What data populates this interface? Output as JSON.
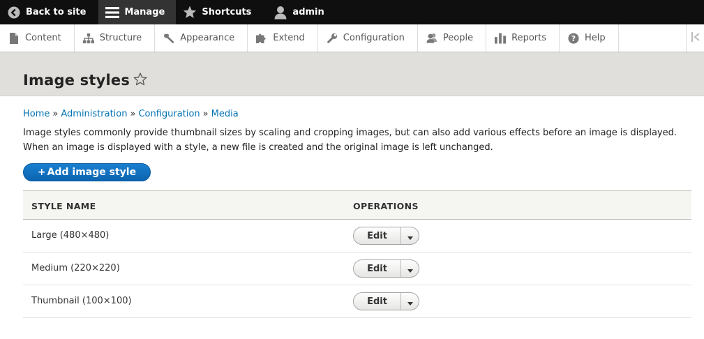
{
  "toolbar": {
    "back_label": "Back to site",
    "manage_label": "Manage",
    "shortcuts_label": "Shortcuts",
    "user_label": "admin"
  },
  "tray": {
    "items": [
      {
        "label": "Content",
        "icon": "document-icon"
      },
      {
        "label": "Structure",
        "icon": "structure-icon"
      },
      {
        "label": "Appearance",
        "icon": "paintbrush-icon"
      },
      {
        "label": "Extend",
        "icon": "puzzle-icon"
      },
      {
        "label": "Configuration",
        "icon": "wrench-icon"
      },
      {
        "label": "People",
        "icon": "people-icon"
      },
      {
        "label": "Reports",
        "icon": "bar-chart-icon"
      },
      {
        "label": "Help",
        "icon": "help-icon"
      }
    ]
  },
  "page": {
    "title": "Image styles"
  },
  "breadcrumb": {
    "items": [
      "Home",
      "Administration",
      "Configuration",
      "Media"
    ],
    "separator": "»"
  },
  "description": {
    "line1": "Image styles commonly provide thumbnail sizes by scaling and cropping images, but can also add various effects before an image is displayed.",
    "line2": "When an image is displayed with a style, a new file is created and the original image is left unchanged."
  },
  "actions": {
    "add_plus": "+",
    "add_label": "Add image style"
  },
  "table": {
    "headers": {
      "name": "STYLE NAME",
      "operations": "OPERATIONS"
    },
    "rows": [
      {
        "name": "Large (480×480)",
        "op": "Edit"
      },
      {
        "name": "Medium (220×220)",
        "op": "Edit"
      },
      {
        "name": "Thumbnail (100×100)",
        "op": "Edit"
      }
    ]
  },
  "colors": {
    "toolbar_bg": "#0f0f0f",
    "link": "#0071b3",
    "primary_button": "#0c71c3",
    "header_bg": "#e0dfdb"
  }
}
